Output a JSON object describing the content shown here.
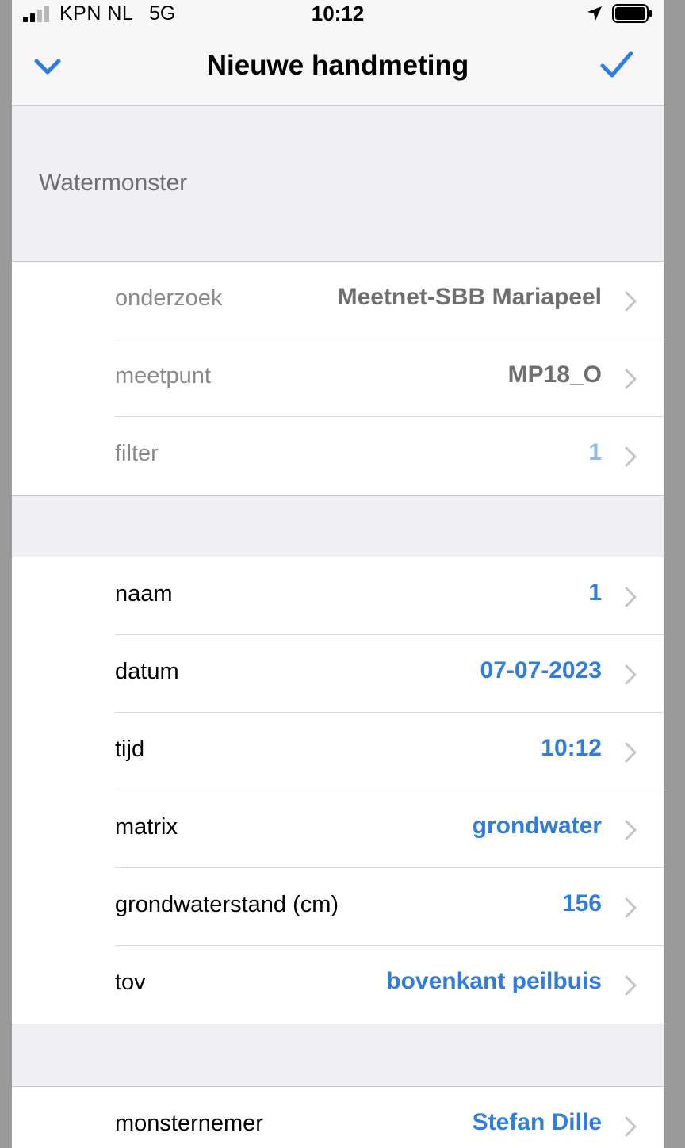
{
  "status_bar": {
    "carrier": "KPN NL",
    "network": "5G",
    "time": "10:12",
    "signal_bars_filled": 2,
    "icons": [
      "location-arrow-icon",
      "battery-icon"
    ]
  },
  "nav": {
    "title": "Nieuwe handmeting",
    "left_icon": "chevron-down-icon",
    "right_icon": "checkmark-icon",
    "accent_color": "#2f7de1"
  },
  "sections": {
    "header": "Watermonster",
    "sample": [
      {
        "label": "onderzoek",
        "value": "Meetnet-SBB Mariapeel"
      },
      {
        "label": "meetpunt",
        "value": "MP18_O"
      },
      {
        "label": "filter",
        "value": "1"
      }
    ],
    "measurement": [
      {
        "label": "naam",
        "value": "1"
      },
      {
        "label": "datum",
        "value": "07-07-2023"
      },
      {
        "label": "tijd",
        "value": "10:12"
      },
      {
        "label": "matrix",
        "value": "grondwater"
      },
      {
        "label": "grondwaterstand (cm)",
        "value": "156"
      },
      {
        "label": "tov",
        "value": "bovenkant peilbuis"
      }
    ],
    "sampler": [
      {
        "label": "monsternemer",
        "value": "Stefan Dille"
      }
    ]
  }
}
